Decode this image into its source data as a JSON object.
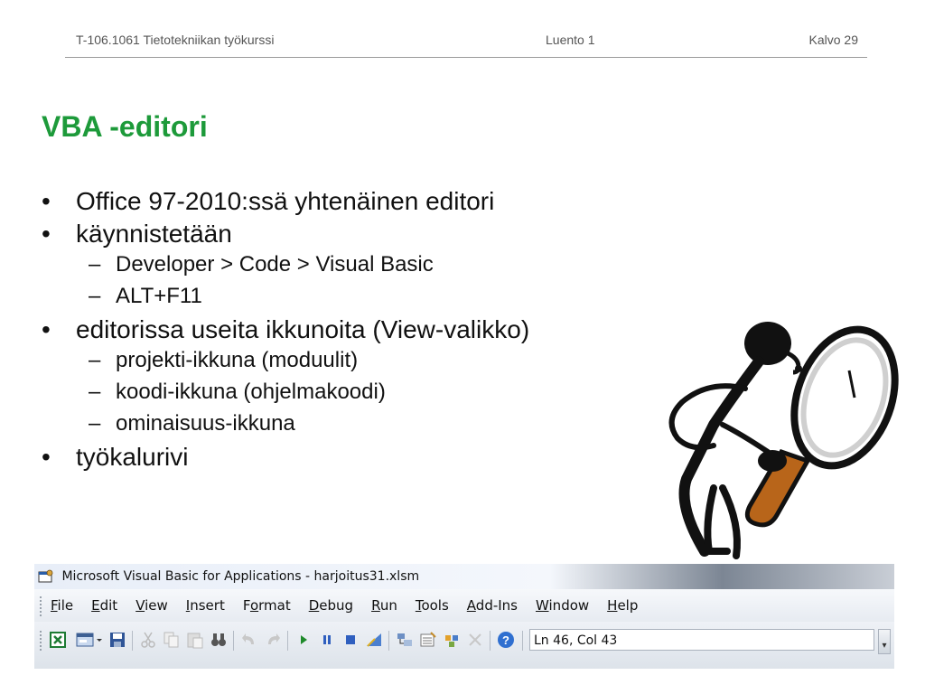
{
  "header": {
    "course": "T-106.1061 Tietotekniikan työkurssi",
    "lecture": "Luento 1",
    "slide": "Kalvo 29"
  },
  "title": "VBA -editori",
  "bullets": [
    {
      "text": "Office 97-2010:ssä yhtenäinen editori"
    },
    {
      "text": "käynnistetään",
      "sub": [
        "Developer > Code > Visual Basic",
        "ALT+F11"
      ]
    },
    {
      "text": "editorissa useita ikkunoita (View-valikko)",
      "sub": [
        "projekti-ikkuna (moduulit)",
        "koodi-ikkuna (ohjelmakoodi)",
        "ominaisuus-ikkuna"
      ]
    },
    {
      "text": "työkalurivi"
    }
  ],
  "bullet_symbol": "•",
  "dash_symbol": "–",
  "vba_window": {
    "title": "Microsoft Visual Basic for Applications - harjoitus31.xlsm",
    "menu": [
      {
        "u": "F",
        "rest": "ile"
      },
      {
        "u": "E",
        "rest": "dit"
      },
      {
        "u": "V",
        "rest": "iew"
      },
      {
        "u": "I",
        "rest": "nsert"
      },
      {
        "pre": "F",
        "u": "o",
        "rest": "rmat"
      },
      {
        "u": "D",
        "rest": "ebug"
      },
      {
        "u": "R",
        "rest": "un"
      },
      {
        "u": "T",
        "rest": "ools"
      },
      {
        "u": "A",
        "rest": "dd-Ins"
      },
      {
        "u": "W",
        "rest": "indow"
      },
      {
        "u": "H",
        "rest": "elp"
      }
    ],
    "status": "Ln 46, Col 43",
    "toolbar_icons": [
      "excel-icon",
      "insert-form-icon",
      "save-icon",
      "cut-icon",
      "copy-icon",
      "paste-icon",
      "find-icon",
      "undo-icon",
      "redo-icon",
      "run-icon",
      "break-icon",
      "reset-icon",
      "design-mode-icon",
      "project-explorer-icon",
      "properties-icon",
      "object-browser-icon",
      "toolbox-icon",
      "help-icon"
    ]
  },
  "colors": {
    "title": "#1d9a3a",
    "magnifier_handle": "#b8651a"
  }
}
